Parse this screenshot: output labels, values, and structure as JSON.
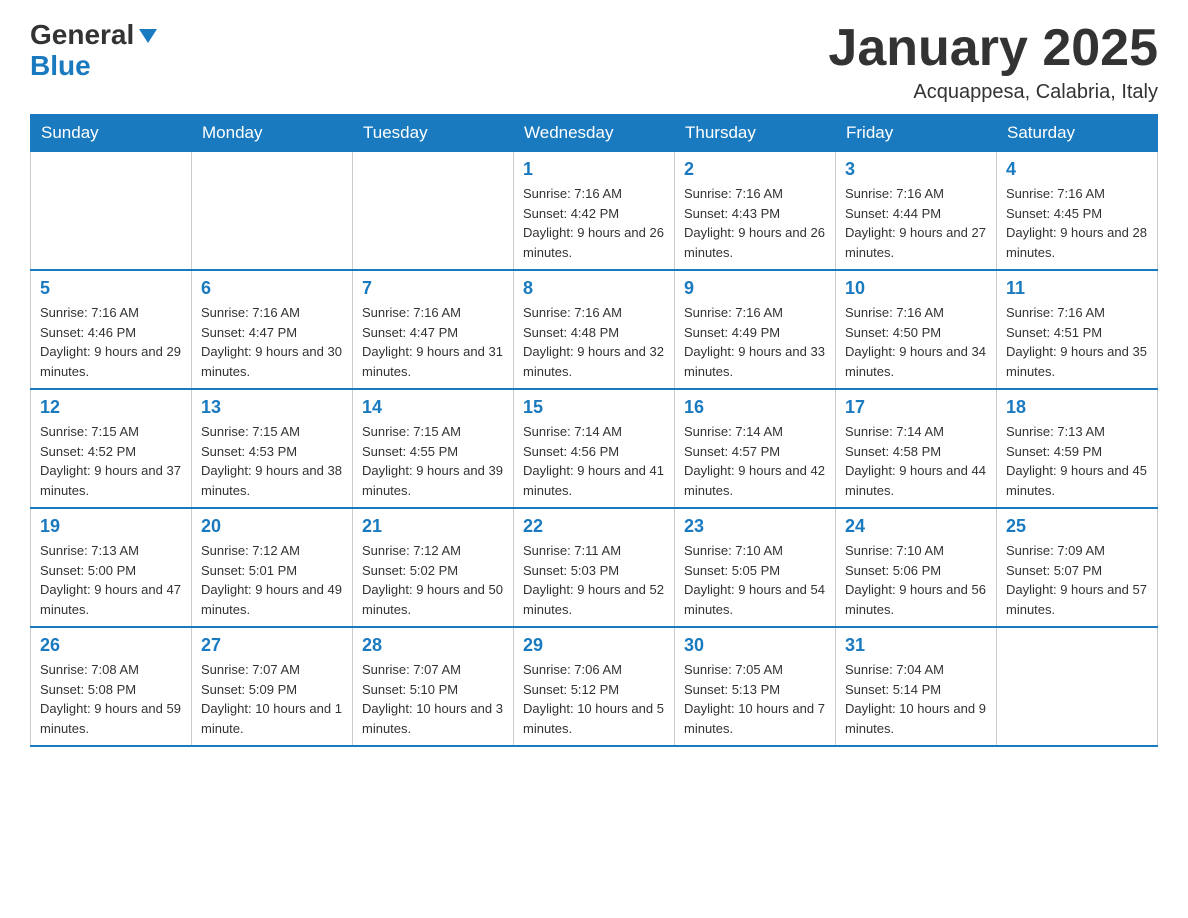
{
  "logo": {
    "general": "General",
    "blue": "Blue",
    "arrow": "▶"
  },
  "title": "January 2025",
  "subtitle": "Acquappesa, Calabria, Italy",
  "days_of_week": [
    "Sunday",
    "Monday",
    "Tuesday",
    "Wednesday",
    "Thursday",
    "Friday",
    "Saturday"
  ],
  "weeks": [
    {
      "cells": [
        {
          "number": "",
          "info": ""
        },
        {
          "number": "",
          "info": ""
        },
        {
          "number": "",
          "info": ""
        },
        {
          "number": "1",
          "info": "Sunrise: 7:16 AM\nSunset: 4:42 PM\nDaylight: 9 hours\nand 26 minutes."
        },
        {
          "number": "2",
          "info": "Sunrise: 7:16 AM\nSunset: 4:43 PM\nDaylight: 9 hours\nand 26 minutes."
        },
        {
          "number": "3",
          "info": "Sunrise: 7:16 AM\nSunset: 4:44 PM\nDaylight: 9 hours\nand 27 minutes."
        },
        {
          "number": "4",
          "info": "Sunrise: 7:16 AM\nSunset: 4:45 PM\nDaylight: 9 hours\nand 28 minutes."
        }
      ]
    },
    {
      "cells": [
        {
          "number": "5",
          "info": "Sunrise: 7:16 AM\nSunset: 4:46 PM\nDaylight: 9 hours\nand 29 minutes."
        },
        {
          "number": "6",
          "info": "Sunrise: 7:16 AM\nSunset: 4:47 PM\nDaylight: 9 hours\nand 30 minutes."
        },
        {
          "number": "7",
          "info": "Sunrise: 7:16 AM\nSunset: 4:47 PM\nDaylight: 9 hours\nand 31 minutes."
        },
        {
          "number": "8",
          "info": "Sunrise: 7:16 AM\nSunset: 4:48 PM\nDaylight: 9 hours\nand 32 minutes."
        },
        {
          "number": "9",
          "info": "Sunrise: 7:16 AM\nSunset: 4:49 PM\nDaylight: 9 hours\nand 33 minutes."
        },
        {
          "number": "10",
          "info": "Sunrise: 7:16 AM\nSunset: 4:50 PM\nDaylight: 9 hours\nand 34 minutes."
        },
        {
          "number": "11",
          "info": "Sunrise: 7:16 AM\nSunset: 4:51 PM\nDaylight: 9 hours\nand 35 minutes."
        }
      ]
    },
    {
      "cells": [
        {
          "number": "12",
          "info": "Sunrise: 7:15 AM\nSunset: 4:52 PM\nDaylight: 9 hours\nand 37 minutes."
        },
        {
          "number": "13",
          "info": "Sunrise: 7:15 AM\nSunset: 4:53 PM\nDaylight: 9 hours\nand 38 minutes."
        },
        {
          "number": "14",
          "info": "Sunrise: 7:15 AM\nSunset: 4:55 PM\nDaylight: 9 hours\nand 39 minutes."
        },
        {
          "number": "15",
          "info": "Sunrise: 7:14 AM\nSunset: 4:56 PM\nDaylight: 9 hours\nand 41 minutes."
        },
        {
          "number": "16",
          "info": "Sunrise: 7:14 AM\nSunset: 4:57 PM\nDaylight: 9 hours\nand 42 minutes."
        },
        {
          "number": "17",
          "info": "Sunrise: 7:14 AM\nSunset: 4:58 PM\nDaylight: 9 hours\nand 44 minutes."
        },
        {
          "number": "18",
          "info": "Sunrise: 7:13 AM\nSunset: 4:59 PM\nDaylight: 9 hours\nand 45 minutes."
        }
      ]
    },
    {
      "cells": [
        {
          "number": "19",
          "info": "Sunrise: 7:13 AM\nSunset: 5:00 PM\nDaylight: 9 hours\nand 47 minutes."
        },
        {
          "number": "20",
          "info": "Sunrise: 7:12 AM\nSunset: 5:01 PM\nDaylight: 9 hours\nand 49 minutes."
        },
        {
          "number": "21",
          "info": "Sunrise: 7:12 AM\nSunset: 5:02 PM\nDaylight: 9 hours\nand 50 minutes."
        },
        {
          "number": "22",
          "info": "Sunrise: 7:11 AM\nSunset: 5:03 PM\nDaylight: 9 hours\nand 52 minutes."
        },
        {
          "number": "23",
          "info": "Sunrise: 7:10 AM\nSunset: 5:05 PM\nDaylight: 9 hours\nand 54 minutes."
        },
        {
          "number": "24",
          "info": "Sunrise: 7:10 AM\nSunset: 5:06 PM\nDaylight: 9 hours\nand 56 minutes."
        },
        {
          "number": "25",
          "info": "Sunrise: 7:09 AM\nSunset: 5:07 PM\nDaylight: 9 hours\nand 57 minutes."
        }
      ]
    },
    {
      "cells": [
        {
          "number": "26",
          "info": "Sunrise: 7:08 AM\nSunset: 5:08 PM\nDaylight: 9 hours\nand 59 minutes."
        },
        {
          "number": "27",
          "info": "Sunrise: 7:07 AM\nSunset: 5:09 PM\nDaylight: 10 hours\nand 1 minute."
        },
        {
          "number": "28",
          "info": "Sunrise: 7:07 AM\nSunset: 5:10 PM\nDaylight: 10 hours\nand 3 minutes."
        },
        {
          "number": "29",
          "info": "Sunrise: 7:06 AM\nSunset: 5:12 PM\nDaylight: 10 hours\nand 5 minutes."
        },
        {
          "number": "30",
          "info": "Sunrise: 7:05 AM\nSunset: 5:13 PM\nDaylight: 10 hours\nand 7 minutes."
        },
        {
          "number": "31",
          "info": "Sunrise: 7:04 AM\nSunset: 5:14 PM\nDaylight: 10 hours\nand 9 minutes."
        },
        {
          "number": "",
          "info": ""
        }
      ]
    }
  ]
}
